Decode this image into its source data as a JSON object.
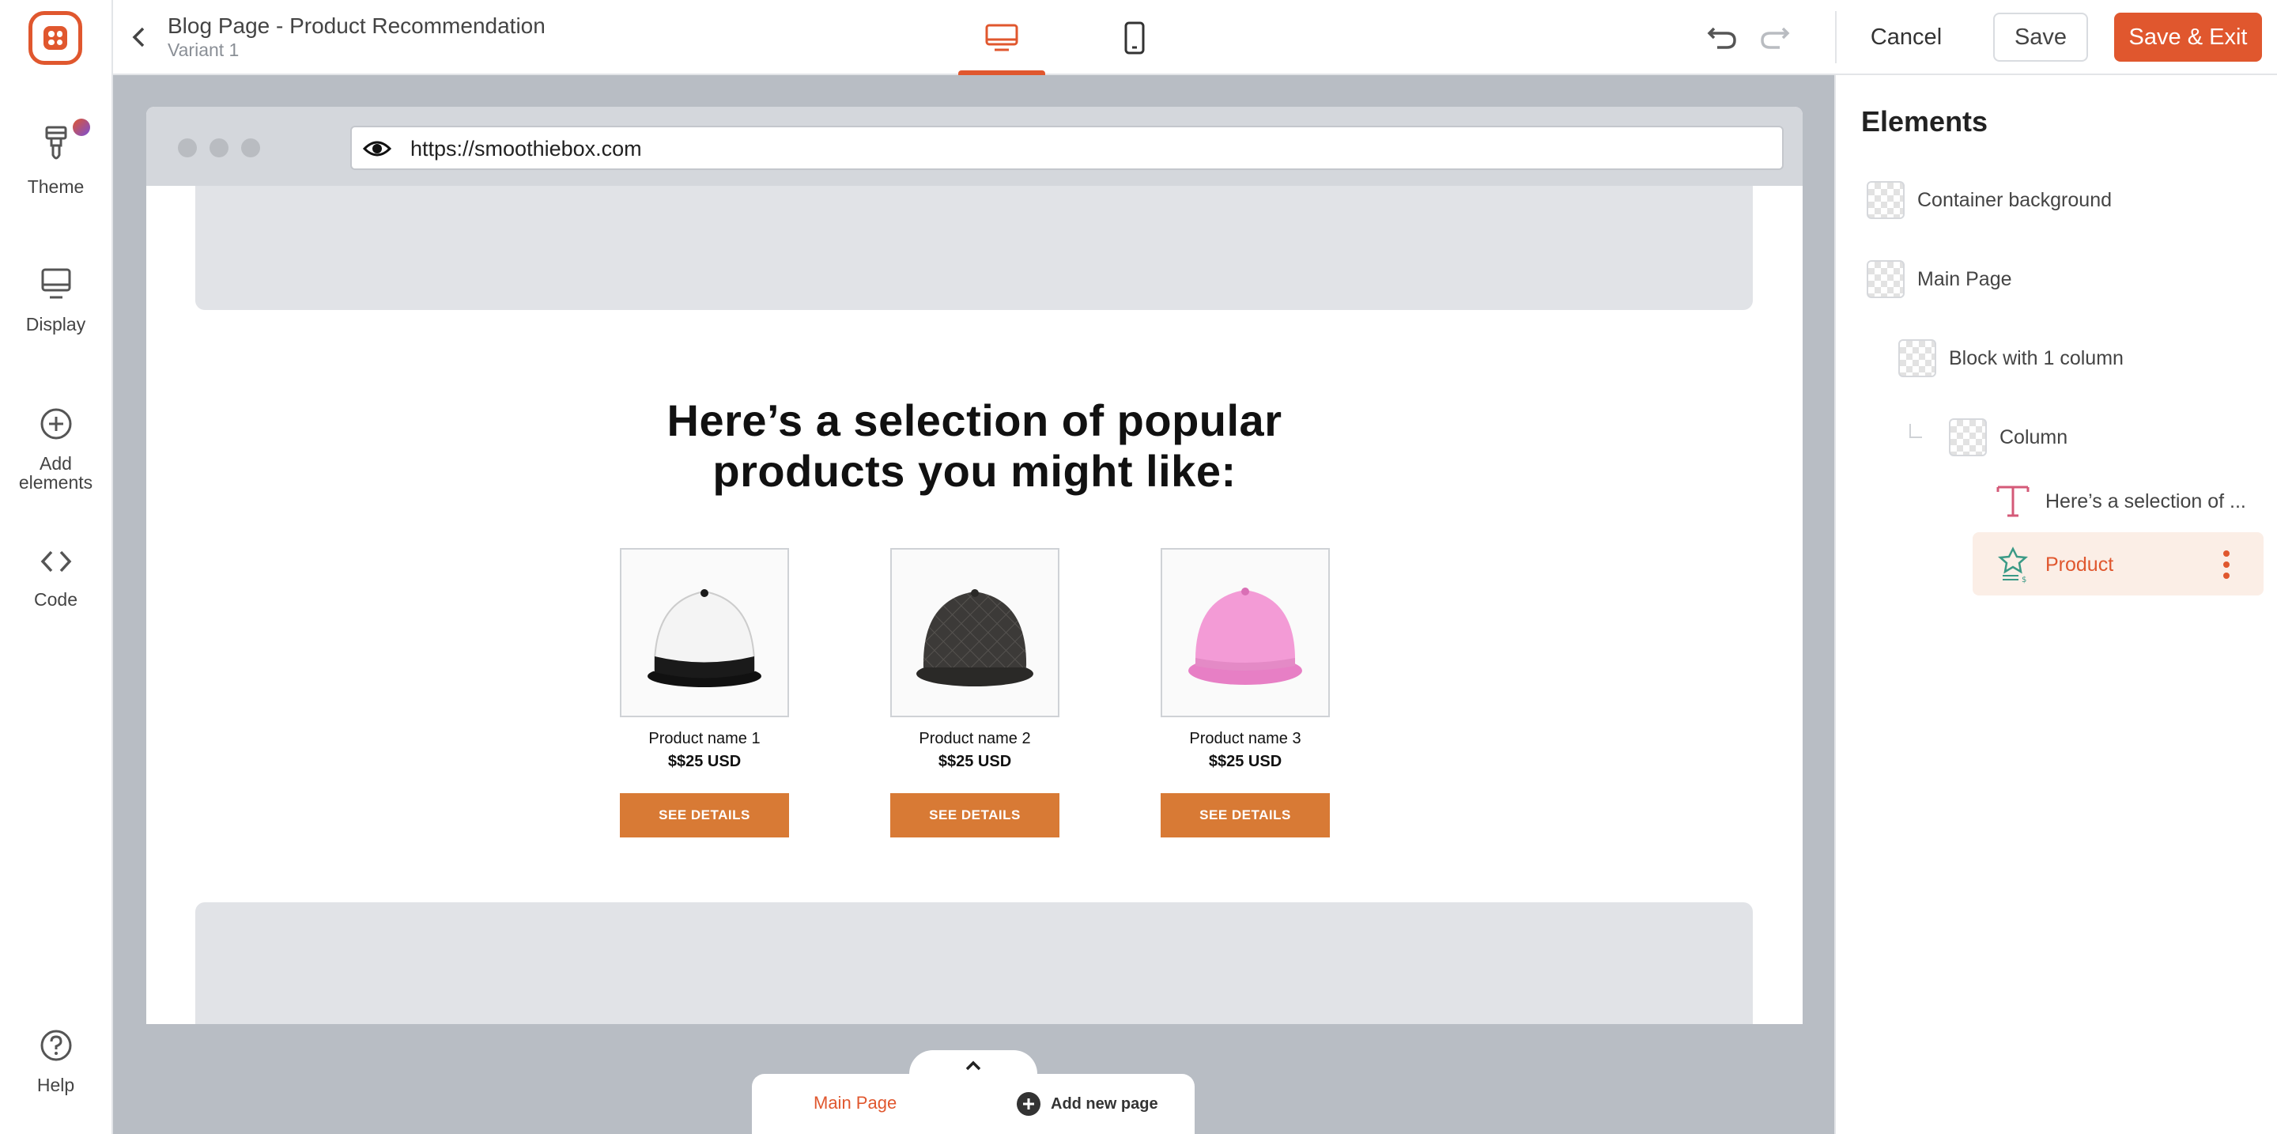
{
  "sidebar": {
    "items": [
      {
        "label": "Theme",
        "icon": "paintbrush-icon"
      },
      {
        "label": "Display",
        "icon": "monitor-icon"
      },
      {
        "label": "Add\nelements",
        "icon": "plus-circle-icon"
      },
      {
        "label": "Code",
        "icon": "code-icon"
      },
      {
        "label": "Help",
        "icon": "help-circle-icon"
      }
    ]
  },
  "header": {
    "title": "Blog Page - Product Recommendation",
    "subtitle": "Variant 1",
    "cancel_label": "Cancel",
    "save_label": "Save",
    "save_exit_label": "Save & Exit",
    "accent_color": "#e0572e"
  },
  "preview": {
    "url": "https://smoothiebox.com",
    "headline": "Here’s a selection of popular products you might like:",
    "products": [
      {
        "name": "Product name 1",
        "price": "$$25 USD",
        "button": "SEE DETAILS",
        "image": "white-black-cap"
      },
      {
        "name": "Product name 2",
        "price": "$$25 USD",
        "button": "SEE DETAILS",
        "image": "black-quilted-cap"
      },
      {
        "name": "Product name 3",
        "price": "$$25 USD",
        "button": "SEE DETAILS",
        "image": "pink-cap"
      }
    ],
    "button_color": "#d87a35"
  },
  "pages": {
    "main_label": "Main Page",
    "add_label": "Add new page"
  },
  "elements_panel": {
    "title": "Elements",
    "layers": [
      {
        "label": "Container background"
      },
      {
        "label": "Main Page"
      },
      {
        "label": "Block with 1 column"
      },
      {
        "label": "Column"
      },
      {
        "label": "Here’s a selection of ..."
      },
      {
        "label": "Product",
        "selected": true
      }
    ]
  }
}
